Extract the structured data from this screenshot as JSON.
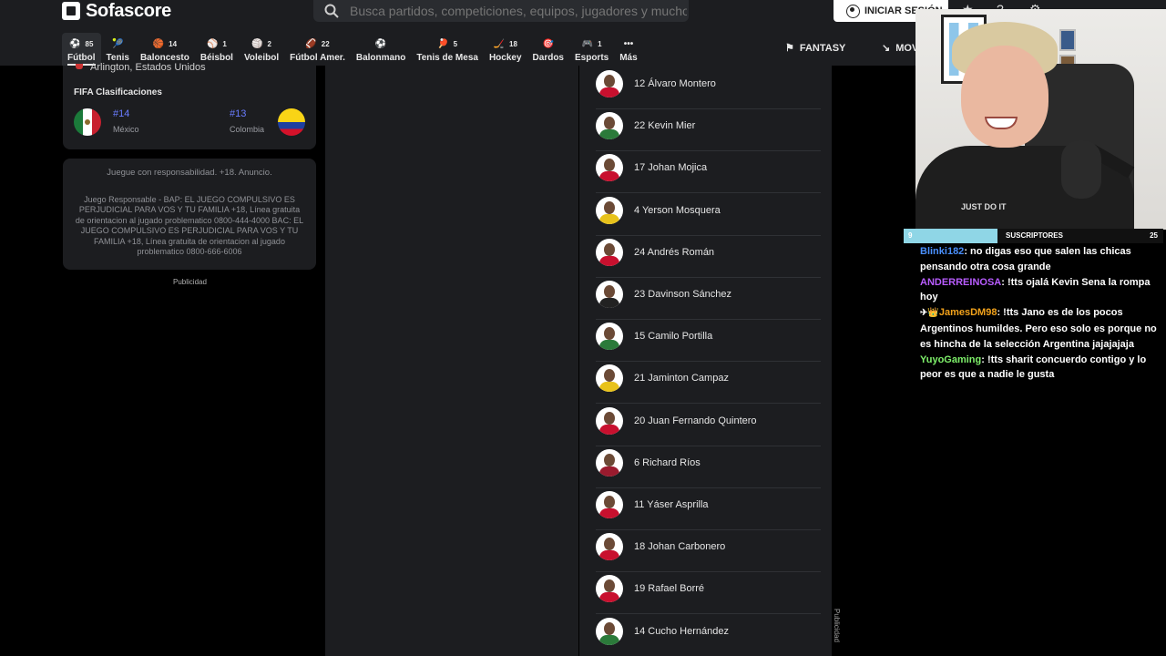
{
  "header": {
    "logo": "Sofascore",
    "search_placeholder": "Busca partidos, competiciones, equipos, jugadores y mucho más",
    "login_label": "INICIAR SESIÓN"
  },
  "nav": [
    {
      "count": "85",
      "label": "Fútbol",
      "icon": "⚽",
      "active": true
    },
    {
      "count": "",
      "label": "Tenis",
      "icon": "🎾"
    },
    {
      "count": "14",
      "label": "Baloncesto",
      "icon": "🏀"
    },
    {
      "count": "1",
      "label": "Béisbol",
      "icon": "⚾"
    },
    {
      "count": "2",
      "label": "Voleibol",
      "icon": "🏐"
    },
    {
      "count": "22",
      "label": "Fútbol Amer.",
      "icon": "🏈"
    },
    {
      "count": "",
      "label": "Balonmano",
      "icon": "⚽"
    },
    {
      "count": "5",
      "label": "Tenis de Mesa",
      "icon": "🏓"
    },
    {
      "count": "18",
      "label": "Hockey",
      "icon": "🏒"
    },
    {
      "count": "",
      "label": "Dardos",
      "icon": "🎯"
    },
    {
      "count": "1",
      "label": "Esports",
      "icon": "🎮"
    },
    {
      "count": "",
      "label": "Más",
      "icon": "•••"
    }
  ],
  "fantasy_label": "FANTASY",
  "mov_label": "MOV",
  "venue": "Arlington, Estados Unidos",
  "fifa": {
    "title": "FIFA Clasificaciones",
    "home": {
      "rank": "#14",
      "country": "México"
    },
    "away": {
      "rank": "#13",
      "country": "Colombia"
    }
  },
  "ad": {
    "headline": "Juegue con responsabilidad. +18. Anuncio.",
    "body": "Juego Responsable - BAP: EL JUEGO COMPULSIVO ES PERJUDICIAL PARA VOS Y TU FAMILIA +18, Línea gratuita de orientacion al jugado problematico 0800-444-4000 BAC: EL JUEGO COMPULSIVO ES PERJUDICIAL PARA VOS Y TU FAMILIA +18, Línea gratuita de orientacion al jugado problematico 0800-666-6006",
    "publicidad": "Publicidad"
  },
  "players": [
    {
      "name": "12 Álvaro Montero",
      "shirt": "#c8102e"
    },
    {
      "name": "22 Kevin Mier",
      "shirt": "#2b7a3a"
    },
    {
      "name": "17 Johan Mojica",
      "shirt": "#c8102e"
    },
    {
      "name": "4 Yerson Mosquera",
      "shirt": "#e8c21b"
    },
    {
      "name": "24 Andrés Román",
      "shirt": "#c8102e"
    },
    {
      "name": "23 Davinson Sánchez",
      "shirt": "#222222"
    },
    {
      "name": "15 Camilo Portilla",
      "shirt": "#2b7a3a"
    },
    {
      "name": "21 Jaminton Campaz",
      "shirt": "#e8c21b"
    },
    {
      "name": "20 Juan Fernando Quintero",
      "shirt": "#c8102e"
    },
    {
      "name": "6 Richard Ríos",
      "shirt": "#9a1b2e"
    },
    {
      "name": "11 Yáser Asprilla",
      "shirt": "#c8102e"
    },
    {
      "name": "18 Johan Carbonero",
      "shirt": "#c8102e"
    },
    {
      "name": "19 Rafael Borré",
      "shirt": "#c8102e"
    },
    {
      "name": "14 Cucho Hernández",
      "shirt": "#2b7a3a"
    }
  ],
  "publicidad_right": "Publicidad",
  "stream": {
    "subs_count": "9",
    "subs_label": "SUSCRIPTORES",
    "subs_goal": "25",
    "subs_progress": 0.36,
    "shirt_text": "JUST DO IT",
    "chat": [
      {
        "user": "Blinki182",
        "text": "no digas eso que salen las chicas pensando otra cosa grande",
        "color": "u1"
      },
      {
        "user": "ANDERREINOSA",
        "text": "!tts ojalá Kevin Sena la rompa hoy",
        "color": "u2"
      },
      {
        "user": "JamesDM98",
        "badge": "✈👑",
        "text": "!tts Jano es de los pocos Argentinos humildes. Pero eso solo es porque no es hincha de la selección Argentina jajajajaja",
        "color": "u3"
      },
      {
        "user": "YuyoGaming",
        "text": "!tts sharit concuerdo contigo y lo peor es que a nadie le gusta",
        "color": "u4"
      }
    ]
  }
}
